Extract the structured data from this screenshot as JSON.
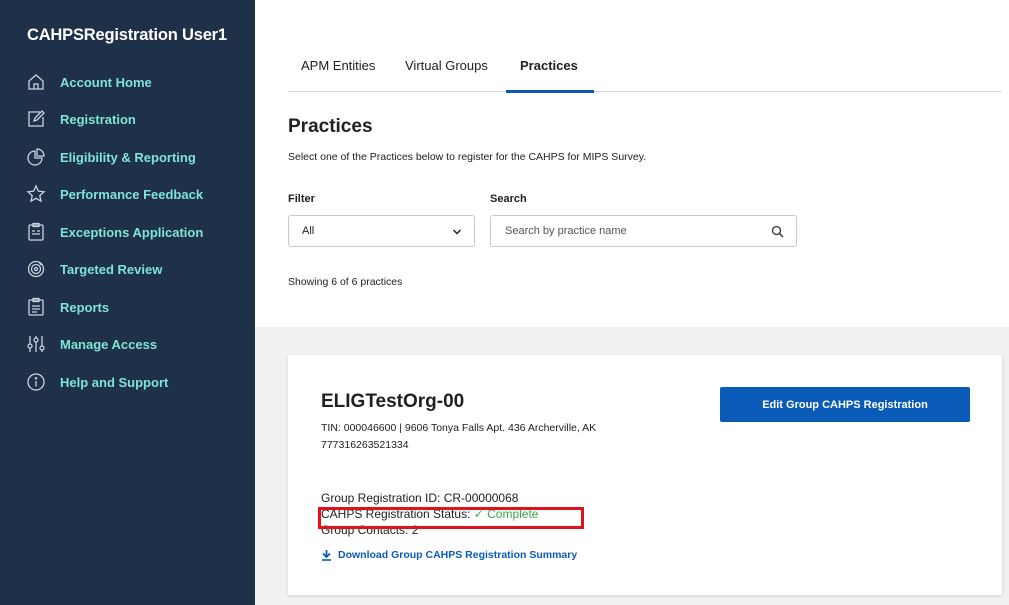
{
  "sidebar": {
    "user_name": "CAHPSRegistration User1",
    "items": [
      {
        "label": "Account Home",
        "icon": "home-icon"
      },
      {
        "label": "Registration",
        "icon": "edit-icon"
      },
      {
        "label": "Eligibility & Reporting",
        "icon": "pie-chart-icon"
      },
      {
        "label": "Performance Feedback",
        "icon": "star-icon"
      },
      {
        "label": "Exceptions Application",
        "icon": "clipboard-icon"
      },
      {
        "label": "Targeted Review",
        "icon": "target-review-icon"
      },
      {
        "label": "Reports",
        "icon": "report-icon"
      },
      {
        "label": "Manage Access",
        "icon": "sliders-icon"
      },
      {
        "label": "Help and Support",
        "icon": "info-icon"
      }
    ]
  },
  "tabs": [
    {
      "label": "APM Entities",
      "active": false
    },
    {
      "label": "Virtual Groups",
      "active": false
    },
    {
      "label": "Practices",
      "active": true
    }
  ],
  "page": {
    "title": "Practices",
    "description": "Select one of the Practices below to register for the CAHPS for MIPS Survey."
  },
  "filter": {
    "label": "Filter",
    "value": "All"
  },
  "search": {
    "label": "Search",
    "placeholder": "Search by practice name"
  },
  "results": {
    "showing_text": "Showing 6 of 6 practices"
  },
  "practice": {
    "name": "ELIGTestOrg-00",
    "tin_line": "TIN: 000046600 | 9606 Tonya Falls Apt. 436 Archerville, AK 777316263521334",
    "edit_button_label": "Edit Group CAHPS Registration",
    "registration_id_label": "Group Registration ID: CR-00000068",
    "status_label": "CAHPS Registration Status: ",
    "status_value": "✓ Complete",
    "contacts_label": "Group Contacts: 2",
    "download_label": "Download Group CAHPS Registration Summary"
  },
  "colors": {
    "sidebar_bg": "#1e3149",
    "nav_text": "#7fe3d8",
    "primary": "#0a5bb7",
    "status_complete": "#3fa64a",
    "highlight": "#e2111a"
  }
}
